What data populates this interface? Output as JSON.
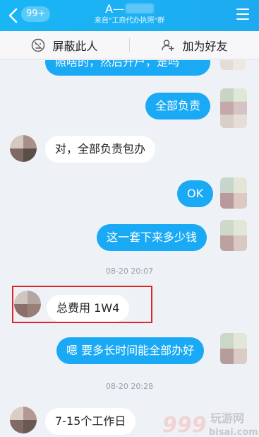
{
  "header": {
    "back_label": "<",
    "unread_badge": "99+",
    "title": "A—",
    "subtitle": "来自\"工商代办执照\"群",
    "menu_icon": "menu-icon"
  },
  "actions": {
    "block_label": "屏蔽此人",
    "add_friend_label": "加为好友"
  },
  "messages": [
    {
      "side": "out",
      "text": "照啥的，然后开户，是吗"
    },
    {
      "side": "out",
      "text": "全部负责"
    },
    {
      "side": "in",
      "text": "对，全部负责包办"
    },
    {
      "side": "out",
      "text": "OK"
    },
    {
      "side": "out",
      "text": "这一套下来多少钱"
    },
    {
      "timestamp": "08-20 20:07"
    },
    {
      "side": "in",
      "text": "总费用 1W4",
      "highlighted": true
    },
    {
      "side": "out",
      "text": "嗯 要多长时间能全部办好"
    },
    {
      "timestamp": "08-20 20:28"
    },
    {
      "side": "in",
      "text": "7-15个工作日"
    }
  ],
  "watermark": {
    "logo_text": "999",
    "site_text": "玩游网",
    "domain_text": "bisai.com"
  },
  "colors": {
    "header_blue": "#1eaaf1",
    "bubble_blue": "#1aa9f4",
    "highlight_red": "#e0262b",
    "background": "#eef1f6"
  }
}
